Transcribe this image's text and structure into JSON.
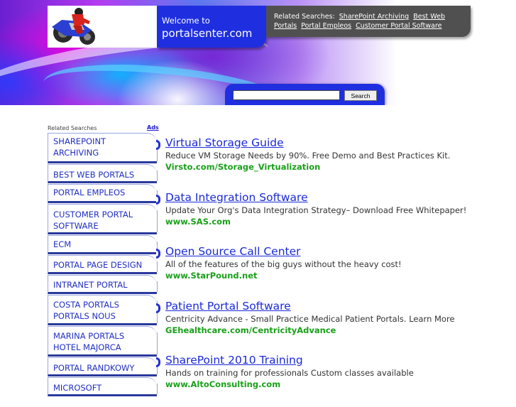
{
  "header": {
    "welcome_small": "Welcome to",
    "site_name": "portalsenter.com",
    "related_label": "Related Searches:",
    "related_links": [
      "SharePoint Archiving",
      "Best Web Portals",
      "Portal Empleos",
      "Customer Portal Software"
    ],
    "search_button": "Search",
    "search_value": ""
  },
  "sidebar": {
    "heading": "Related Searches",
    "ads_label": "Ads",
    "items": [
      "SHAREPOINT ARCHIVING",
      "BEST WEB PORTALS",
      "PORTAL EMPLEOS",
      "CUSTOMER PORTAL SOFTWARE",
      "ECM",
      "PORTAL PAGE DESIGN",
      "INTRANET PORTAL",
      "COSTA PORTALS PORTALS NOUS",
      "MARINA PORTALS HOTEL MAJORCA",
      "PORTAL RANDKOWY",
      "MICROSOFT"
    ]
  },
  "ads": [
    {
      "title": "Virtual Storage Guide",
      "desc": "Reduce VM Storage Needs by 90%. Free Demo and Best Practices Kit.",
      "url": "Virsto.com/Storage_Virtualization"
    },
    {
      "title": "Data Integration Software",
      "desc": "Update Your Org's Data Integration Strategy– Download Free Whitepaper!",
      "url": "www.SAS.com"
    },
    {
      "title": "Open Source Call Center",
      "desc": "All of the features of the big guys without the heavy cost!",
      "url": "www.StarPound.net"
    },
    {
      "title": "Patient Portal Software",
      "desc": "Centricity Advance - Small Practice Medical Patient Portals. Learn More",
      "url": "GEhealthcare.com/CentricityAdvance"
    },
    {
      "title": "SharePoint 2010 Training",
      "desc": "Hands on training for professionals Custom classes available",
      "url": "www.AltoConsulting.com"
    }
  ],
  "colors": {
    "brand_blue": "#1f2fe0",
    "link_blue": "#1a2ad8",
    "url_green": "#1aa01a",
    "related_bg": "#505050"
  }
}
